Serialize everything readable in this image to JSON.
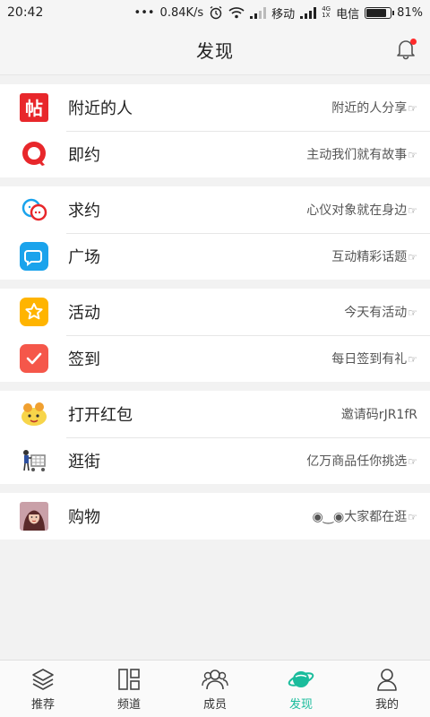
{
  "status_bar": {
    "time": "20:42",
    "dots": "•••",
    "speed": "0.84K/s",
    "carrier1": "移动",
    "network_tag_4g": "4G",
    "network_tag_1x": "1X",
    "carrier2": "电信",
    "battery": "81%"
  },
  "header": {
    "title": "发现"
  },
  "groups": [
    {
      "rows": [
        {
          "label": "附近的人",
          "hint": "附近的人分享",
          "hand": "☞",
          "icon": "tie-icon"
        },
        {
          "label": "即约",
          "hint": "主动我们就有故事",
          "hand": "☞",
          "icon": "date-icon"
        }
      ]
    },
    {
      "rows": [
        {
          "label": "求约",
          "hint": "心仪对象就在身边",
          "hand": "☞",
          "icon": "chat-bubbles-icon"
        },
        {
          "label": "广场",
          "hint": "互动精彩话题",
          "hand": "☞",
          "icon": "square-chat-icon"
        }
      ]
    },
    {
      "rows": [
        {
          "label": "活动",
          "hint": "今天有活动",
          "hand": "☞",
          "icon": "star-icon"
        },
        {
          "label": "签到",
          "hint": "每日签到有礼",
          "hand": "☞",
          "icon": "checkin-icon"
        }
      ]
    },
    {
      "rows": [
        {
          "label": "打开红包",
          "hint": "邀请码rJR1fR",
          "hand": "",
          "icon": "red-packet-icon"
        },
        {
          "label": "逛街",
          "hint": "亿万商品任你挑选",
          "hand": "☞",
          "icon": "shopping-cart-icon"
        }
      ]
    },
    {
      "rows": [
        {
          "label": "购物",
          "hint": "◉‿◉大家都在逛",
          "hand": "☞",
          "icon": "shopping-avatar-icon"
        }
      ]
    }
  ],
  "tie_icon_char": "帖",
  "bottom_nav": [
    {
      "label": "推荐",
      "icon": "layers-icon"
    },
    {
      "label": "频道",
      "icon": "channels-icon"
    },
    {
      "label": "成员",
      "icon": "members-icon"
    },
    {
      "label": "发现",
      "icon": "planet-icon",
      "active": true
    },
    {
      "label": "我的",
      "icon": "profile-icon"
    }
  ],
  "colors": {
    "accent": "#1abc9c",
    "red": "#e8272b",
    "blue": "#1aa3ec",
    "yellow": "#ffb400",
    "coral": "#f5574a"
  }
}
